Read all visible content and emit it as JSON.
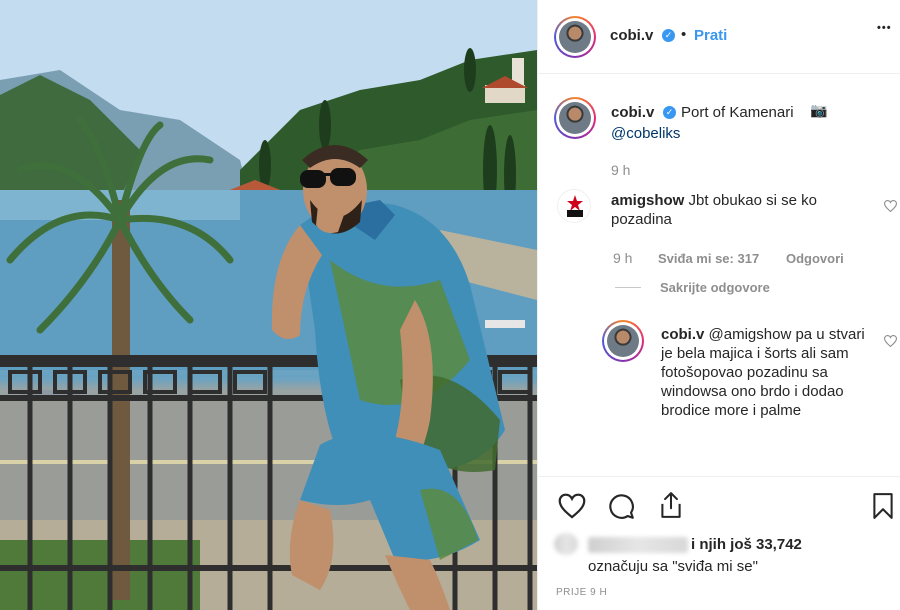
{
  "post": {
    "username": "cobi.v",
    "follow_label": "Prati",
    "dot": "•",
    "more": "•••",
    "location": "Port of Kamenari",
    "location_emoji": "📷",
    "mention": "@cobeliks",
    "time": "9 h"
  },
  "comment1": {
    "username": "amigshow",
    "text": "Jbt obukao si se ko pozadina",
    "time": "9 h",
    "likes": "Sviđa mi se: 317",
    "reply": "Odgovori",
    "hide_replies": "Sakrijte odgovore"
  },
  "reply1": {
    "username": "cobi.v",
    "text": "@amigshow pa u stvari je bela majica i šorts ali sam fotošopovao pozadinu sa windowsa ono brdo i dodao brodice more i palme"
  },
  "likes": {
    "others": "i njih još 33,742",
    "line2": "označuju sa \"sviđa mi se\"",
    "ago": "PRIJE 9 H"
  },
  "colors": {
    "link": "#3897f0",
    "muted": "#8e8e8e",
    "text": "#262626"
  }
}
